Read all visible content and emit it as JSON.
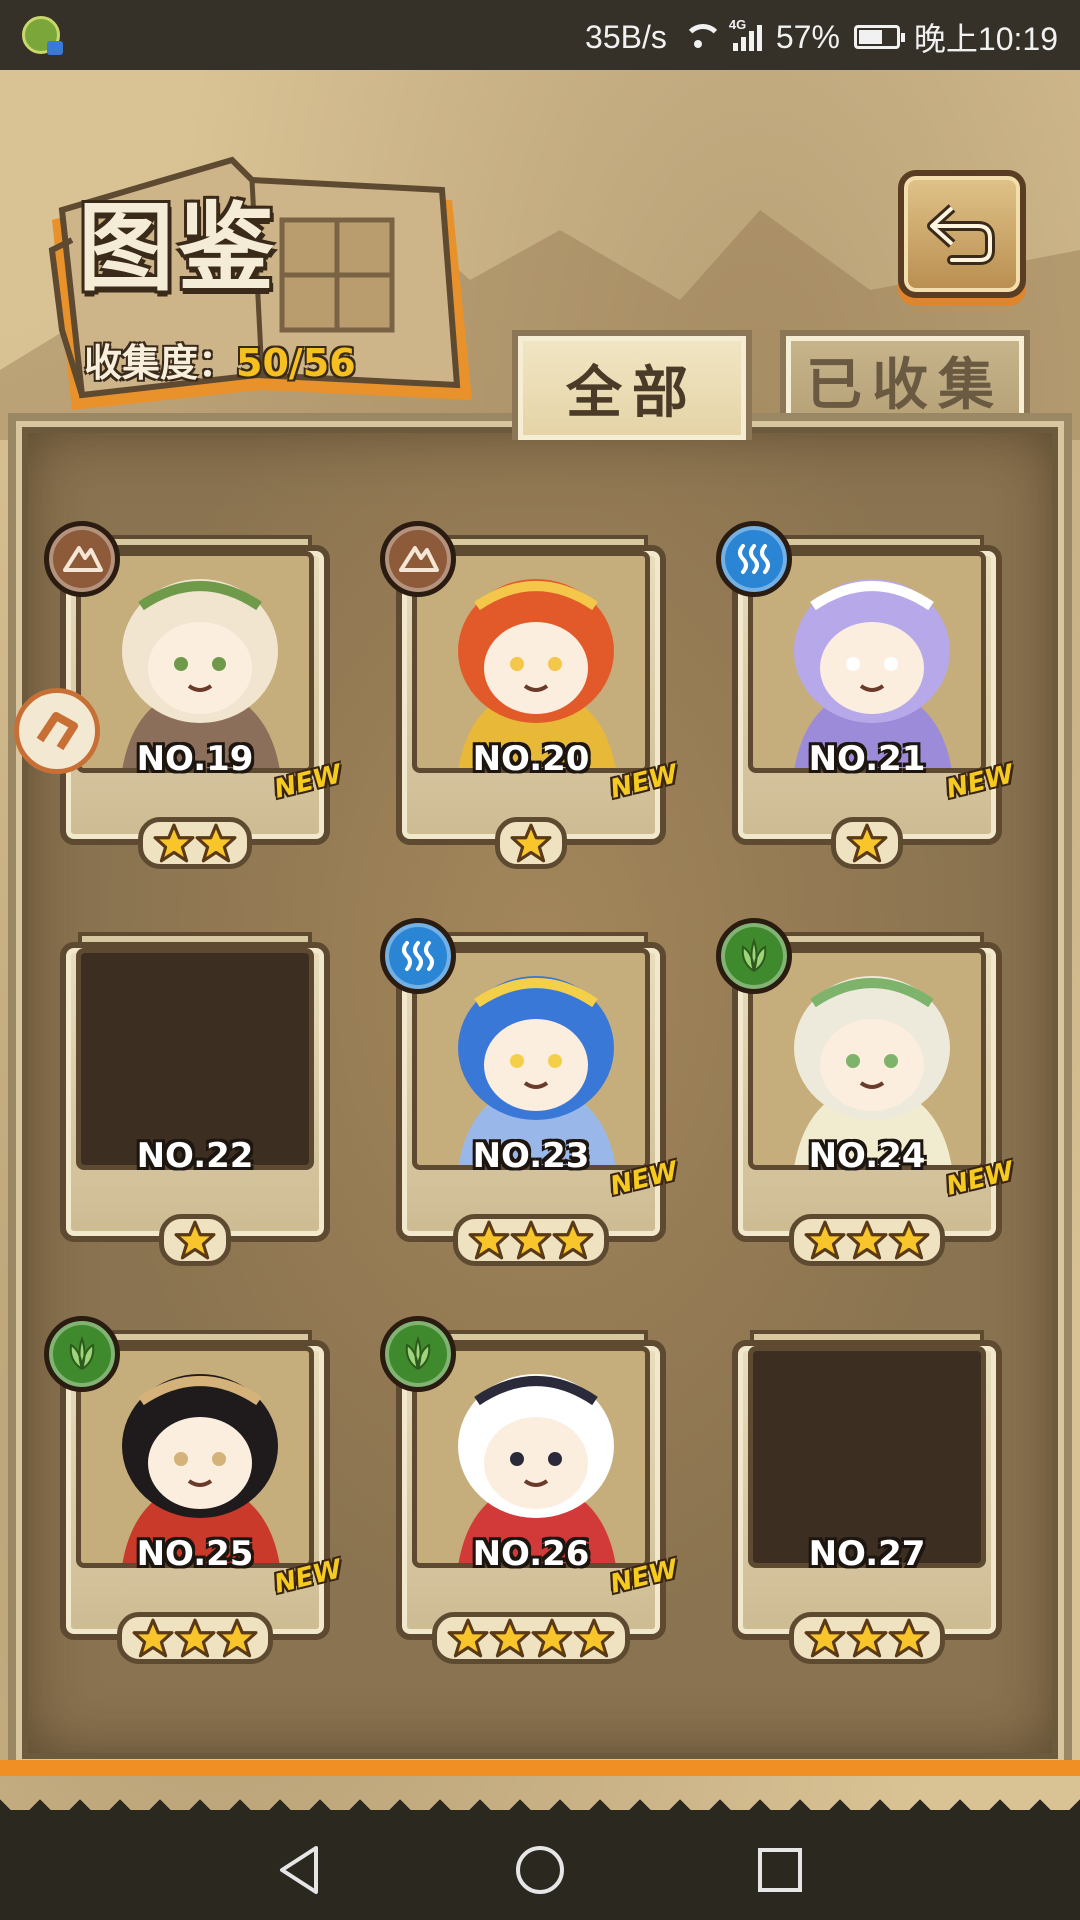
{
  "status_bar": {
    "speed": "35B/s",
    "network": "4G",
    "battery": "57%",
    "time": "晚上10:19"
  },
  "header": {
    "title": "图鉴",
    "collection_label": "收集度：",
    "collection_count": "50/56"
  },
  "tabs": [
    {
      "label": "全部",
      "active": true
    },
    {
      "label": "已收集",
      "active": false
    }
  ],
  "cards": [
    {
      "number": "NO.19",
      "stars": 2,
      "new": "NEW",
      "element": "earth-icon",
      "collected": true,
      "colors": [
        "#f1e5d0",
        "#6f9a4a",
        "#8c6f5a"
      ]
    },
    {
      "number": "NO.20",
      "stars": 1,
      "new": "NEW",
      "element": "earth-icon",
      "collected": true,
      "colors": [
        "#e25a2a",
        "#f4c64a",
        "#e8b838"
      ]
    },
    {
      "number": "NO.21",
      "stars": 1,
      "new": "NEW",
      "element": "water-icon",
      "collected": true,
      "colors": [
        "#b7a8ea",
        "#ffffff",
        "#9b8bd8"
      ]
    },
    {
      "number": "NO.22",
      "stars": 1,
      "new": "",
      "element": "",
      "collected": false,
      "colors": []
    },
    {
      "number": "NO.23",
      "stars": 3,
      "new": "NEW",
      "element": "water-icon",
      "collected": true,
      "colors": [
        "#3a78d8",
        "#f4d04a",
        "#9ab7ea"
      ]
    },
    {
      "number": "NO.24",
      "stars": 3,
      "new": "NEW",
      "element": "leaf-icon",
      "collected": true,
      "colors": [
        "#eeeadb",
        "#7db36a",
        "#f1ecd0"
      ]
    },
    {
      "number": "NO.25",
      "stars": 3,
      "new": "NEW",
      "element": "leaf-icon",
      "collected": true,
      "colors": [
        "#1f1b1c",
        "#d4b27a",
        "#c93a2a"
      ]
    },
    {
      "number": "NO.26",
      "stars": 4,
      "new": "NEW",
      "element": "leaf-icon",
      "collected": true,
      "colors": [
        "#ffffff",
        "#2a2a3a",
        "#d23a3a"
      ]
    },
    {
      "number": "NO.27",
      "stars": 3,
      "new": "",
      "element": "",
      "collected": false,
      "colors": []
    }
  ]
}
